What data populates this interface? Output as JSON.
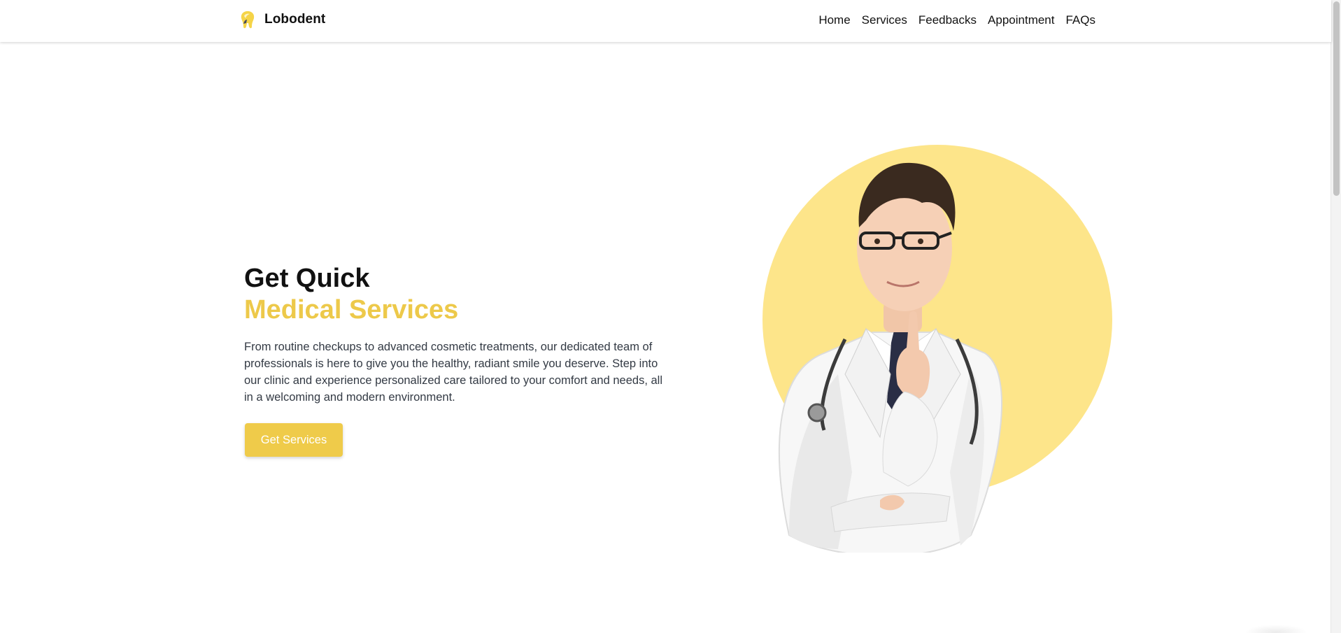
{
  "brand": {
    "name": "Lobodent",
    "logo_icon": "tooth-icon"
  },
  "nav": {
    "items": [
      {
        "label": "Home"
      },
      {
        "label": "Services"
      },
      {
        "label": "Feedbacks"
      },
      {
        "label": "Appointment"
      },
      {
        "label": "FAQs"
      }
    ]
  },
  "hero": {
    "title_line1": "Get Quick",
    "title_line2": "Medical Services",
    "description": "From routine checkups to advanced cosmetic treatments, our dedicated team of professionals is here to give you the healthy, radiant smile you deserve. Step into our clinic and experience personalized care tailored to your comfort and needs, all in a welcoming and modern environment.",
    "cta_label": "Get Services"
  },
  "colors": {
    "accent": "#efcb4a",
    "accent_light": "#fde58a",
    "text": "#111111"
  }
}
